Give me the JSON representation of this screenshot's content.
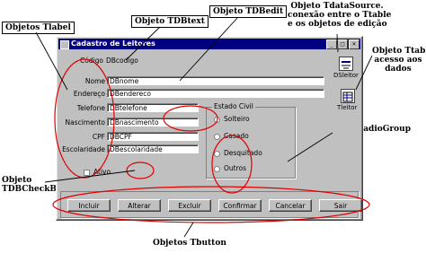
{
  "annotations": {
    "tlabel": "Objetos Tlabel",
    "tdbtext": "Objeto TDBtext",
    "tdbedit": "Objeto TDBedit",
    "tdatasource_line1": "Objeto TdataSource.",
    "tdatasource_line2": "conexão entre o Ttable",
    "tdatasource_line3": "e os objetos de edição",
    "ttable_line1": "Objeto Ttable.",
    "ttable_line2": "acesso aos",
    "ttable_line3": "dados",
    "tdbradiogroup": "Obejto TDBRadioGroup",
    "tdbcheckbox_line1": "Objeto",
    "tdbcheckbox_line2": "TDBCheckBox",
    "tbutton": "Objetos Tbutton"
  },
  "window": {
    "title": "Cadastro de Leitores",
    "minimize": "_",
    "maximize": "□",
    "close": "×"
  },
  "form": {
    "codigo_label": "Código",
    "codigo_value": "DBcodigo",
    "nome_label": "Nome",
    "nome_value": "DBnome",
    "endereco_label": "Endereço",
    "endereco_value": "DBendereco",
    "telefone_label": "Telefone",
    "telefone_value": "DBtelefone",
    "nascimento_label": "Nascimento",
    "nascimento_value": "DBnascimento",
    "cpf_label": "CPF",
    "cpf_value": "DBCPF",
    "escolaridade_label": "Escolaridade",
    "escolaridade_value": "DBescolaridade",
    "ativo_label": "Ativo"
  },
  "estado_civil": {
    "label": "Estado Civil",
    "options": [
      "Solteiro",
      "Casado",
      "Desquitado",
      "Outros"
    ]
  },
  "components": {
    "datasource_label": "DSleitor",
    "table_label": "Tleitor"
  },
  "buttons": {
    "incluir": "Incluir",
    "alterar": "Alterar",
    "excluir": "Excluir",
    "confirmar": "Confirmar",
    "cancelar": "Cancelar",
    "sair": "Sair"
  }
}
